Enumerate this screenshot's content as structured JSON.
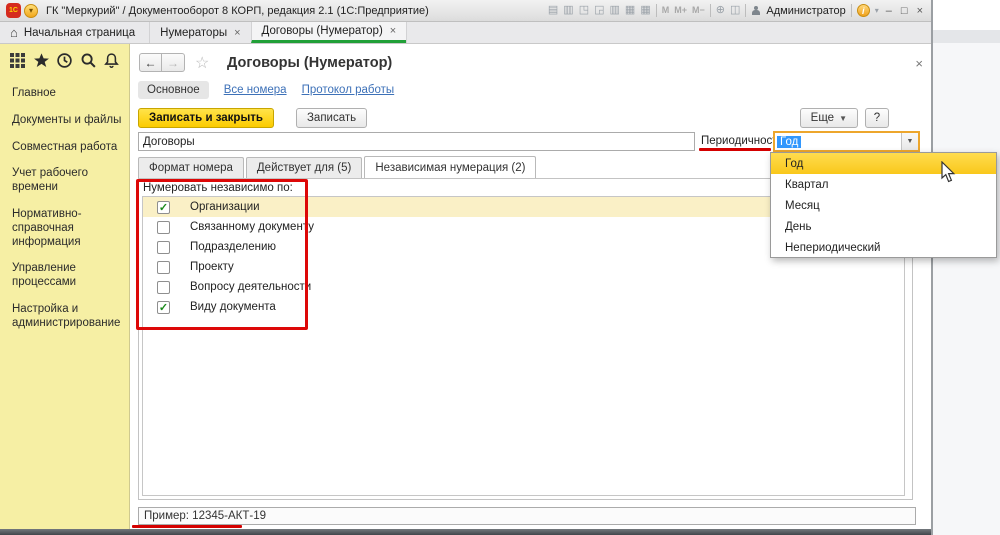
{
  "window": {
    "title": "ГК \"Меркурий\" / Документооборот 8 КОРП, редакция 2.1  (1С:Предприятие)",
    "logo": "1С",
    "minimize": "–",
    "maximize": "□",
    "close": "×"
  },
  "titlebar": {
    "icons": [
      "▤",
      "▥",
      "◳",
      "◲",
      "▥",
      "▦",
      "▦"
    ],
    "mem_buttons": [
      "M",
      "M+",
      "M−"
    ],
    "zoom_icon": "⊕",
    "split_icon": "◫",
    "user": "Администратор",
    "info_icon": "i",
    "dropdown_arrow": "▾"
  },
  "tabs": {
    "home": "Начальная страница",
    "home_icon": "⌂",
    "close_icon": "×",
    "items": [
      {
        "label": "Нумераторы"
      },
      {
        "label": "Договоры (Нумератор)"
      }
    ]
  },
  "sidebar": {
    "items": [
      {
        "label": "Главное"
      },
      {
        "label": "Документы и файлы"
      },
      {
        "label": "Совместная работа"
      },
      {
        "label": "Учет рабочего времени"
      },
      {
        "label": "Нормативно-справочная информация"
      },
      {
        "label": "Управление процессами"
      },
      {
        "label": "Настройка и администрирование"
      }
    ]
  },
  "form": {
    "title": "Договоры (Нумератор)",
    "back": "←",
    "forward": "→",
    "star": "☆",
    "close": "×",
    "nav": [
      {
        "label": "Основное"
      },
      {
        "label": "Все номера"
      },
      {
        "label": "Протокол работы"
      }
    ],
    "buttons": {
      "save_close": "Записать и закрыть",
      "save": "Записать",
      "more": "Еще",
      "more_arrow": "▼",
      "help": "?"
    },
    "name_value": "Договоры",
    "periodicity_label": "Периодичность:",
    "periodicity_value": "Год",
    "combo_arrow": "▼",
    "page_tabs": [
      {
        "label": "Формат номера"
      },
      {
        "label": "Действует для (5)"
      },
      {
        "label": "Независимая нумерация (2)"
      }
    ],
    "group_label": "Нумеровать независимо по:",
    "check_glyph": "✓",
    "checkboxes": [
      {
        "label": "Организации",
        "checked": true
      },
      {
        "label": "Связанному документу",
        "checked": false
      },
      {
        "label": "Подразделению",
        "checked": false
      },
      {
        "label": "Проекту",
        "checked": false
      },
      {
        "label": "Вопросу деятельности",
        "checked": false
      },
      {
        "label": "Виду документа",
        "checked": true
      }
    ],
    "example": "Пример: 12345-АКТ-19"
  },
  "dropdown": {
    "options": [
      "Год",
      "Квартал",
      "Месяц",
      "День",
      "Непериодический"
    ],
    "highlighted": "Год"
  },
  "colors": {
    "accent_green": "#21A038",
    "primary_yellow": "#FBCB00",
    "annotation_red": "#DD0808",
    "selection_blue": "#3297FD",
    "sidebar_yellow": "#F6EFA4",
    "row_highlight": "#FAF0C6"
  }
}
